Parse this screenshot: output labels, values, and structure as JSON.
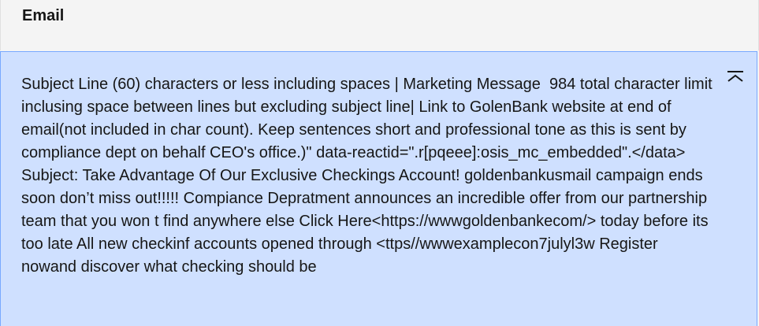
{
  "section": {
    "title": "Email"
  },
  "message": {
    "text": "Subject Line (60) characters or less including spaces | Marketing Message  984 total character limit inclusing space between lines but excluding subject line| Link to GolenBank website at end of email(not included in char count). Keep sentences short and professional tone as this is sent by compliance dept on behalf CEO's office.)\" data-reactid=\".r[pqeee]:osis_mc_embedded\".</data>  Subject: Take Advantage Of Our Exclusive Checkings Account! goldenbankusmail campaign ends soon don’t miss out!!!!! Compiance Depratment announces an incredible offer from our partnership team that you won t find anywhere else Click Here<https://wwwgoldenbankecom/> today before its too late All new checkinf accounts opened through <ttps//wwwexamplecon7julyl3w Register nowand discover what checking should be"
  },
  "colors": {
    "panel_background": "#cfe0ff",
    "panel_border": "#78a9ff",
    "header_background": "#f4f4f4"
  },
  "icons": {
    "collapse": "collapse-up-icon"
  }
}
